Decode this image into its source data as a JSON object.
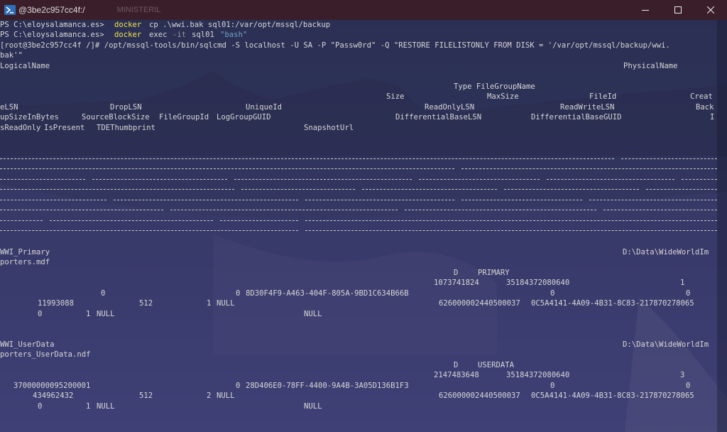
{
  "window": {
    "title": "@3be2c957cc4f:/",
    "ghost_title": "MINISTERIL",
    "minimize": "—",
    "maximize": "☐",
    "close": "✕"
  },
  "terminal": {
    "prompt_ps": "PS C:\\eloysalamanca.es>",
    "cmd1_docker": "docker",
    "cmd1_args": "cp .\\wwi.bak sql01:/var/opt/mssql/backup",
    "cmd2_docker": "docker",
    "cmd2_exec": "exec",
    "cmd2_flag": "-it",
    "cmd2_container": "sql01",
    "cmd2_str": "\"bash\"",
    "cmd3_line1": "[root@3be2c957cc4f /]# /opt/mssql-tools/bin/sqlcmd -S localhost -U SA -P \"Passw0rd\" -Q \"RESTORE FILELISTONLY FROM DISK = '/var/opt/mssql/backup/wwi.",
    "cmd3_line2": "bak'\"",
    "headers": {
      "logical_name": "LogicalName",
      "physical_name": "PhysicalName",
      "type_fg": "Type FileGroupName",
      "size": "Size",
      "maxsize": "MaxSize",
      "fileid": "FileId",
      "creat": "Creat",
      "elsn": "eLSN",
      "droplsn": "DropLSN",
      "uniqueid": "UniqueId",
      "readonlylsn": "ReadOnlyLSN",
      "readwritelsn": "ReadWriteLSN",
      "back": "Back",
      "upsize": "upSizeInBytes",
      "sourceblock": "SourceBlockSize",
      "filegroupid": "FileGroupId",
      "loggroupguid": "LogGroupGUID",
      "diffbaselsn": "DifferentialBaseLSN",
      "diffbaseguid": "DifferentialBaseGUID",
      "i": "I",
      "isreadonly": "sReadOnly",
      "ispresent": "IsPresent",
      "tde": "TDEThumbprint",
      "snapshoturl": "SnapshotUrl"
    },
    "rows": [
      {
        "logical": "WWI_Primary",
        "physical": "D:\\Data\\WideWorldIm",
        "physical2": "porters.mdf",
        "type": "D",
        "fg": "PRIMARY",
        "size": "1073741824",
        "maxsize": "35184372080640",
        "fileid": "1",
        "a": "0",
        "b": "0",
        "guid": "8D30F4F9-A463-404F-805A-9BD1C634B66B",
        "c": "0",
        "d": "0",
        "backup": "11993088",
        "block": "512",
        "fgid": "1",
        "null1": "NULL",
        "difflsn": "626000002440500037",
        "diffguid": "0C5A4141-4A09-4B31-8C83-217870278065",
        "ro": "0",
        "pres": "1",
        "null2": "NULL",
        "null3": "NULL"
      },
      {
        "logical": "WWI_UserData",
        "physical": "D:\\Data\\WideWorldIm",
        "physical2": "porters_UserData.ndf",
        "type": "D",
        "fg": "USERDATA",
        "size": "2147483648",
        "maxsize": "35184372080640",
        "fileid": "3",
        "a": "37000000095200001",
        "b": "0",
        "guid": "28D406E0-78FF-4400-9A4B-3A05D136B1F3",
        "c": "0",
        "d": "0",
        "backup": "434962432",
        "block": "512",
        "fgid": "2",
        "null1": "NULL",
        "difflsn": "626000002440500037",
        "diffguid": "0C5A4141-4A09-4B31-8C83-217870278065",
        "ro": "0",
        "pres": "1",
        "null2": "NULL",
        "null3": "NULL"
      }
    ]
  }
}
